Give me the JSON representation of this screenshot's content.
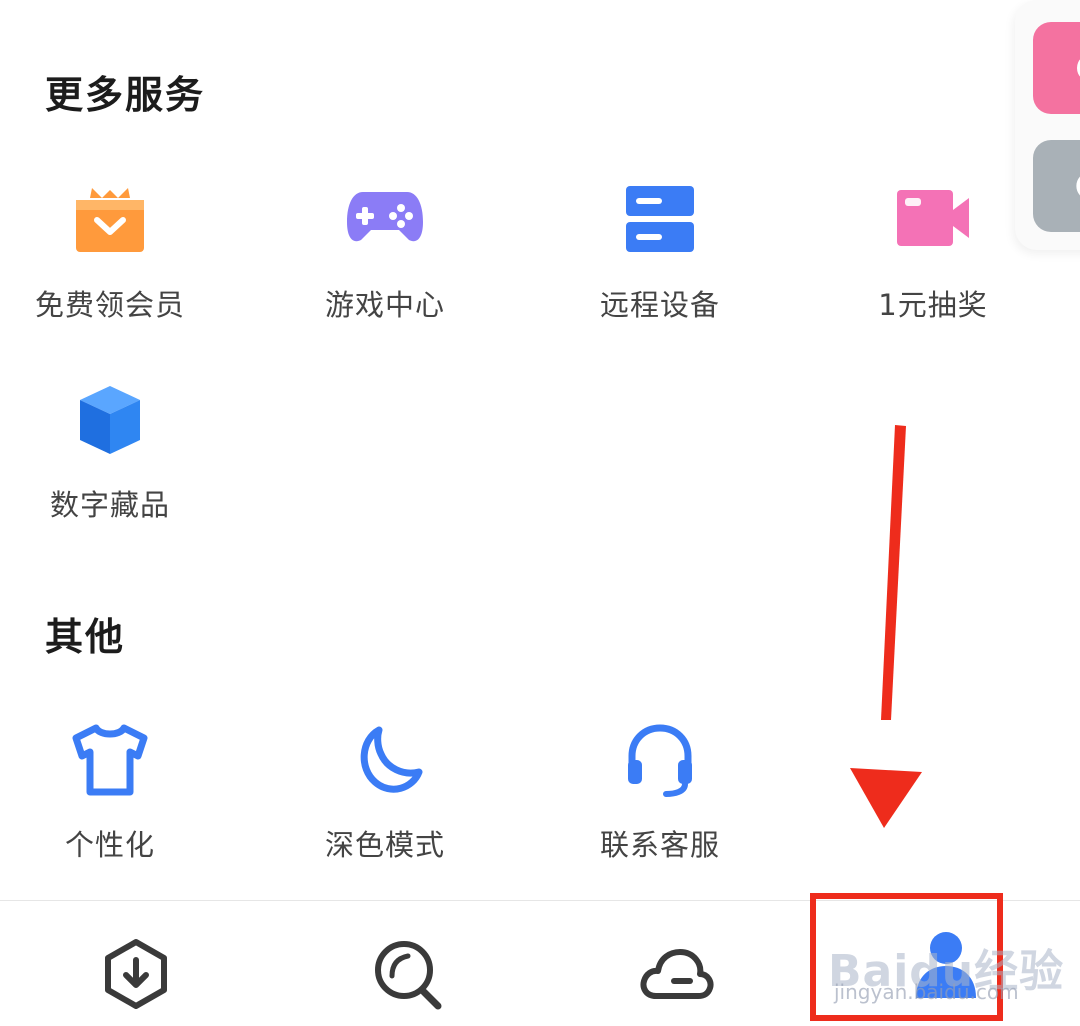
{
  "sections": {
    "more_services": {
      "title": "更多服务",
      "items": [
        {
          "label": "免费领会员",
          "icon": "gift-box-icon"
        },
        {
          "label": "游戏中心",
          "icon": "gamepad-icon"
        },
        {
          "label": "远程设备",
          "icon": "server-icon"
        },
        {
          "label": "1元抽奖",
          "icon": "video-camera-icon"
        },
        {
          "label": "数字藏品",
          "icon": "cube-icon"
        }
      ]
    },
    "other": {
      "title": "其他",
      "items": [
        {
          "label": "个性化",
          "icon": "tshirt-icon"
        },
        {
          "label": "深色模式",
          "icon": "moon-icon"
        },
        {
          "label": "联系客服",
          "icon": "headset-icon"
        }
      ]
    }
  },
  "bottom_nav": [
    {
      "icon": "download-icon"
    },
    {
      "icon": "search-icon"
    },
    {
      "icon": "cloud-icon"
    },
    {
      "icon": "profile-icon",
      "active": true
    }
  ],
  "watermark": {
    "logo": "Baidu经验",
    "url": "jingyan.baidu.com"
  },
  "colors": {
    "orange": "#ff9a3c",
    "purple": "#8b7cf6",
    "blue": "#3b7cf5",
    "pink": "#f472b6",
    "red_annotation": "#ee2c1c",
    "icon_gray": "#3a3a3a"
  }
}
